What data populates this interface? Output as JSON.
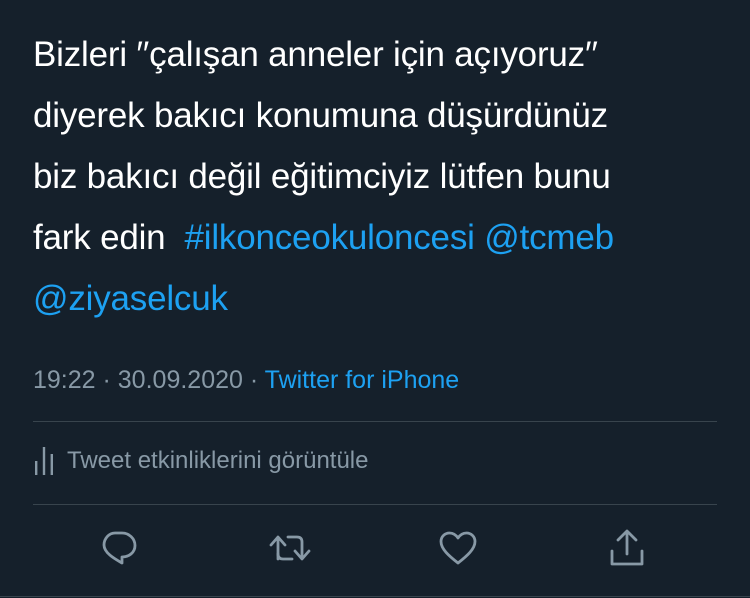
{
  "tweet": {
    "text_lines": [
      "Bizleri ′′çalışan anneler için açıyoruz′′",
      "diyerek bakıcı konumuna düşürdünüz",
      "biz bakıcı değil eğitimciyiz lütfen bunu",
      "fark edin  "
    ],
    "hashtag": "#ilkonceokuloncesi",
    "mention_1": "@tcmeb",
    "mention_2": "@ziyaselcuk",
    "time": "19:22",
    "separator_1": " · ",
    "date": "30.09.2020",
    "separator_2": " · ",
    "source": "Twitter for iPhone"
  },
  "activity": {
    "label": "Tweet etkinliklerini görüntüle",
    "icon": "analytics-icon"
  },
  "actions": [
    {
      "name": "reply",
      "icon": "reply-icon"
    },
    {
      "name": "retweet",
      "icon": "retweet-icon"
    },
    {
      "name": "like",
      "icon": "like-icon"
    },
    {
      "name": "share",
      "icon": "share-icon"
    }
  ],
  "colors": {
    "background": "#15202b",
    "text": "#ffffff",
    "link": "#1da1f2",
    "secondary": "#8899a6",
    "divider": "#38444d"
  }
}
